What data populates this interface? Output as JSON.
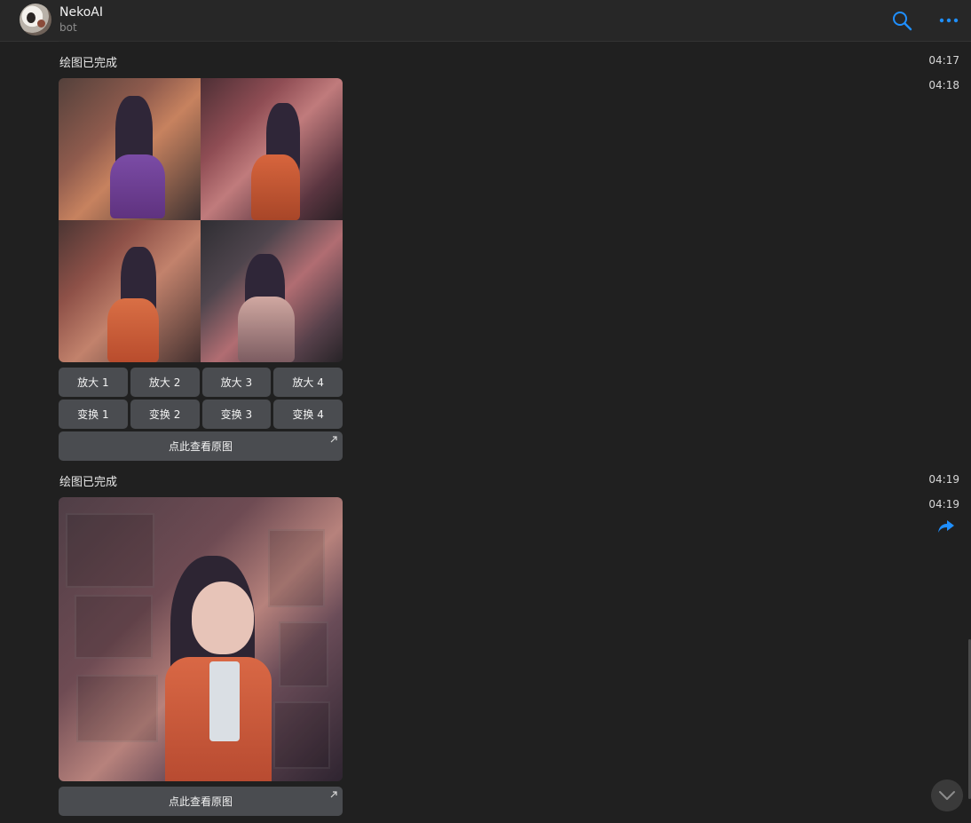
{
  "header": {
    "title": "NekoAI",
    "subtitle": "bot",
    "icons": {
      "search": "search-icon",
      "more": "more-icon"
    },
    "accent_color": "#1f8fff"
  },
  "messages": [
    {
      "status_text": "绘图已完成",
      "status_time": "04:17",
      "image_time": "04:18",
      "buttons_row_1": [
        "放大 1",
        "放大 2",
        "放大 3",
        "放大 4"
      ],
      "buttons_row_2": [
        "变换 1",
        "变换 2",
        "变换 3",
        "变换 4"
      ],
      "view_original_label": "点此查看原图"
    },
    {
      "status_text": "绘图已完成",
      "status_time": "04:19",
      "image_time": "04:19",
      "view_original_label": "点此查看原图"
    }
  ],
  "icons": {
    "external_link": "external-link-icon",
    "share": "share-icon",
    "scroll_down": "chevron-down-icon"
  }
}
